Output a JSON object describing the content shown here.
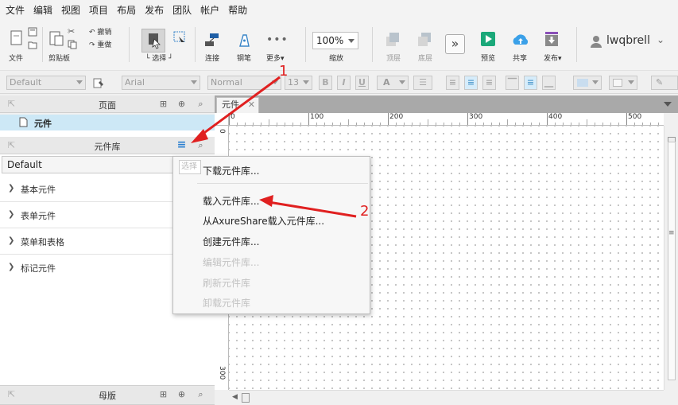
{
  "menubar": {
    "items": [
      "文件",
      "编辑",
      "视图",
      "项目",
      "布局",
      "发布",
      "团队",
      "帐户",
      "帮助"
    ]
  },
  "toolbar": {
    "file_label": "文件",
    "clipboard_label": "剪贴板",
    "undo_label": "撤销",
    "redo_label": "重做",
    "select_label": "选择",
    "connect_label": "连接",
    "pen_label": "钢笔",
    "more_label": "更多▾",
    "zoom_value": "100%",
    "zoom_label": "缩放",
    "top_label": "顶层",
    "bottom_label": "底层",
    "preview_label": "预览",
    "share_label": "共享",
    "publish_label": "发布▾",
    "user_name": "lwqbrell"
  },
  "formatbar": {
    "style_value": "Default",
    "font_value": "Arial",
    "weight_value": "Normal",
    "size_value": "13",
    "bold": "B",
    "italic": "I",
    "underline": "U",
    "font_color": "A"
  },
  "pages_panel": {
    "title": "页面",
    "page_item": "元件"
  },
  "library_panel": {
    "title": "元件库",
    "selected_library": "Default",
    "categories": [
      "基本元件",
      "表单元件",
      "菜单和表格",
      "标记元件"
    ]
  },
  "masters_panel": {
    "title": "母版"
  },
  "canvas": {
    "tab_label": "元件",
    "ruler_top": [
      "0",
      "100",
      "200",
      "300",
      "400",
      "500"
    ],
    "ruler_left": [
      "0",
      "300"
    ]
  },
  "dropdown": {
    "items": [
      {
        "label": "下载元件库...",
        "enabled": true
      },
      {
        "label": "载入元件库...",
        "enabled": true
      },
      {
        "label": "从AxureShare载入元件库...",
        "enabled": true
      },
      {
        "label": "创建元件库...",
        "enabled": true
      },
      {
        "label": "编辑元件库...",
        "enabled": false
      },
      {
        "label": "刷新元件库",
        "enabled": false
      },
      {
        "label": "卸载元件库",
        "enabled": false
      }
    ],
    "search_hint": "选择"
  },
  "annotations": {
    "label1": "1",
    "label2": "2",
    "color": "#e02020"
  },
  "colors": {
    "selection": "#cde8f6",
    "accent_blue": "#2a7fd0",
    "preview_green": "#1aa879",
    "share_blue": "#3aa0e8",
    "publish_purple": "#8a4fb7"
  }
}
